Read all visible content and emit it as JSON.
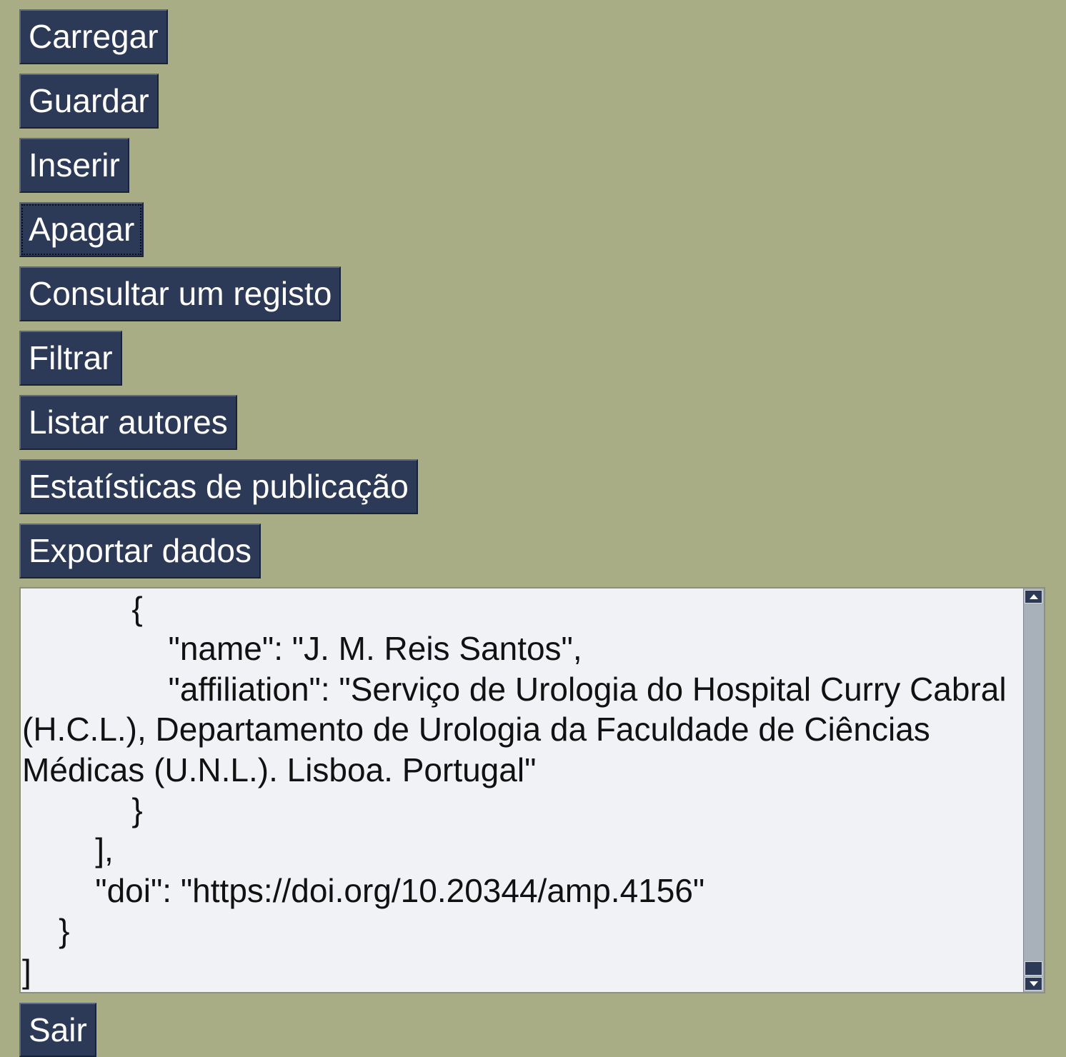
{
  "menu": {
    "buttons": [
      {
        "id": "load",
        "label": "Carregar"
      },
      {
        "id": "save",
        "label": "Guardar"
      },
      {
        "id": "insert",
        "label": "Inserir"
      },
      {
        "id": "delete",
        "label": "Apagar"
      },
      {
        "id": "view-record",
        "label": "Consultar um registo"
      },
      {
        "id": "filter",
        "label": "Filtrar"
      },
      {
        "id": "list-authors",
        "label": "Listar autores"
      },
      {
        "id": "publication-stats",
        "label": "Estatísticas de publicação"
      },
      {
        "id": "export-data",
        "label": "Exportar dados"
      }
    ]
  },
  "editor": {
    "content": "            {\n                \"name\": \"J. M. Reis Santos\",\n                \"affiliation\": \"Serviço de Urologia do Hospital Curry Cabral (H.C.L.), Departamento de Urologia da Faculdade de Ciências Médicas (U.N.L.). Lisboa. Portugal\"\n            }\n        ],\n        \"doi\": \"https://doi.org/10.20344/amp.4156\"\n    }\n]",
    "scroll_position": 1.0
  },
  "footer": {
    "exit_label": "Sair"
  },
  "colors": {
    "background": "#a8ad86",
    "button": "#2c3a58",
    "button_text": "#ffffff",
    "editor_background": "#f1f2f6",
    "scrollbar_trough": "#a8b0ba"
  }
}
